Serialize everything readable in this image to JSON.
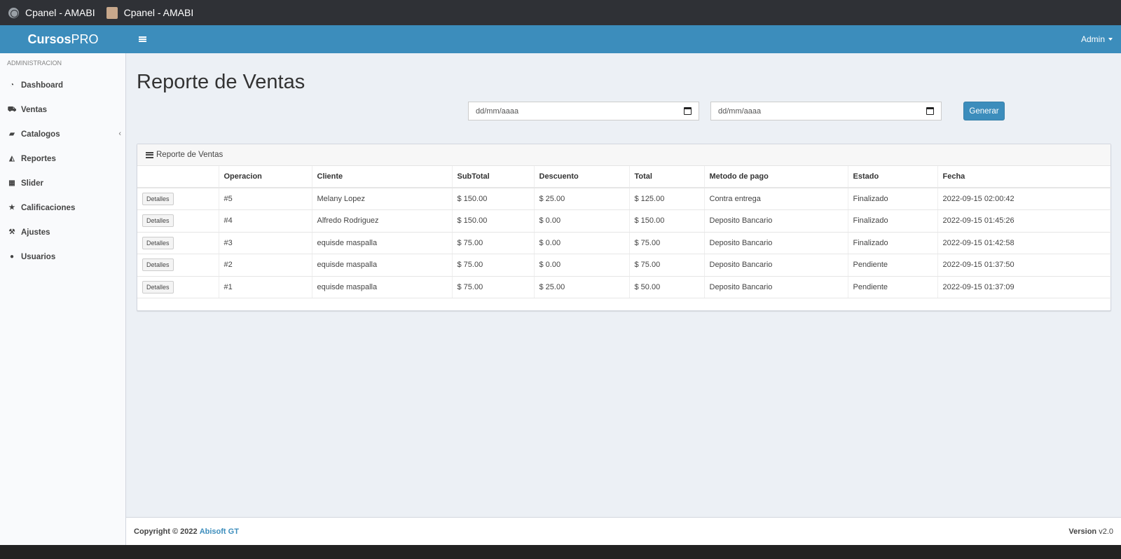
{
  "browser": {
    "tabs": [
      {
        "title": "Cpanel - AMABI",
        "icon": "globe-icon"
      },
      {
        "title": "Cpanel - AMABI",
        "icon": "site-favicon"
      }
    ]
  },
  "header": {
    "logo_bold": "Cursos",
    "logo_light": "PRO",
    "user_menu": "Admin",
    "colors": {
      "primary": "#3c8dbc"
    }
  },
  "sidebar": {
    "section": "ADMINISTRACION",
    "items": [
      {
        "label": "Dashboard",
        "icon": "dashboard-icon"
      },
      {
        "label": "Ventas",
        "icon": "cart-icon"
      },
      {
        "label": "Catalogos",
        "icon": "folder-icon"
      },
      {
        "label": "Reportes",
        "icon": "area-chart-icon"
      },
      {
        "label": "Slider",
        "icon": "th-large-icon"
      },
      {
        "label": "Calificaciones",
        "icon": "star-icon"
      },
      {
        "label": "Ajustes",
        "icon": "wrench-icon"
      },
      {
        "label": "Usuarios",
        "icon": "user-icon"
      }
    ]
  },
  "main": {
    "title": "Reporte de Ventas",
    "date_from": {
      "placeholder": "dd/mm/aaaa"
    },
    "date_to": {
      "placeholder": "dd/mm/aaaa"
    },
    "generate_label": "Generar",
    "box_title": "Reporte de Ventas",
    "table": {
      "columns": [
        "",
        "Operacion",
        "Cliente",
        "SubTotal",
        "Descuento",
        "Total",
        "Metodo de pago",
        "Estado",
        "Fecha"
      ],
      "details_label": "Detalles",
      "rows": [
        {
          "op": "#5",
          "cliente": "Melany Lopez",
          "subtotal": "$ 150.00",
          "descuento": "$ 25.00",
          "total": "$ 125.00",
          "metodo": "Contra entrega",
          "estado": "Finalizado",
          "fecha": "2022-09-15 02:00:42"
        },
        {
          "op": "#4",
          "cliente": "Alfredo Rodriguez",
          "subtotal": "$ 150.00",
          "descuento": "$ 0.00",
          "total": "$ 150.00",
          "metodo": "Deposito Bancario",
          "estado": "Finalizado",
          "fecha": "2022-09-15 01:45:26"
        },
        {
          "op": "#3",
          "cliente": "equisde maspalla",
          "subtotal": "$ 75.00",
          "descuento": "$ 0.00",
          "total": "$ 75.00",
          "metodo": "Deposito Bancario",
          "estado": "Finalizado",
          "fecha": "2022-09-15 01:42:58"
        },
        {
          "op": "#2",
          "cliente": "equisde maspalla",
          "subtotal": "$ 75.00",
          "descuento": "$ 0.00",
          "total": "$ 75.00",
          "metodo": "Deposito Bancario",
          "estado": "Pendiente",
          "fecha": "2022-09-15 01:37:50"
        },
        {
          "op": "#1",
          "cliente": "equisde maspalla",
          "subtotal": "$ 75.00",
          "descuento": "$ 25.00",
          "total": "$ 50.00",
          "metodo": "Deposito Bancario",
          "estado": "Pendiente",
          "fecha": "2022-09-15 01:37:09"
        }
      ]
    }
  },
  "footer": {
    "copyright": "Copyright © 2022",
    "company": "Abisoft GT",
    "version_label": "Version",
    "version": "v2.0"
  }
}
